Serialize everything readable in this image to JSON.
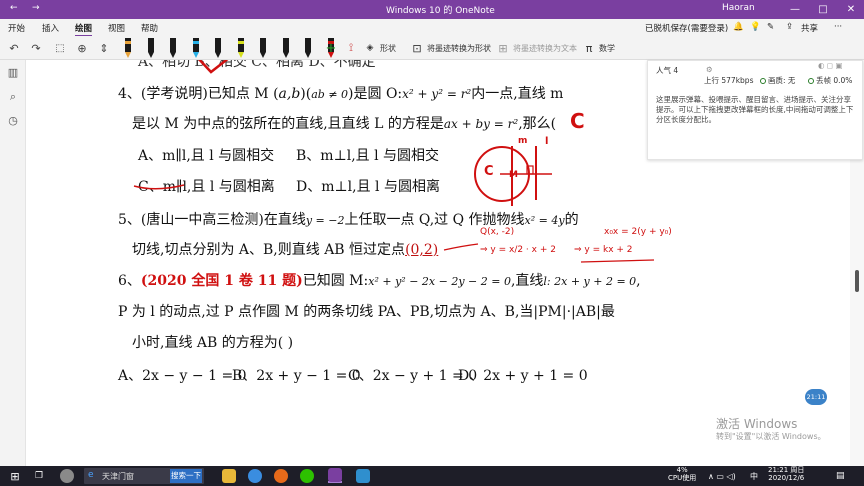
{
  "titlebar": {
    "title": "Windows 10 的 OneNote",
    "user": "Haoran",
    "back_glyph": "←",
    "forward_glyph": "→",
    "minimize_glyph": "—",
    "maximize_glyph": "□",
    "close_glyph": "✕"
  },
  "ribbon": {
    "tabs": [
      "开始",
      "插入",
      "绘图",
      "视图",
      "帮助"
    ],
    "active_tab": "绘图",
    "status": "已脱机保存(需要登录)",
    "share": "共享",
    "more": "···"
  },
  "toolbar": {
    "undo": "↶",
    "redo": "↷",
    "ink_to_shape": "将墨迹转换为形状",
    "ink_to_text": "将墨迹转换为文本",
    "shape": "形状",
    "math": "数学",
    "pen_colors": [
      "#e8a33b",
      "#1a1a1a",
      "#1a1a1a",
      "#27b0e6",
      "#1a1a1a",
      "#d6e01e",
      "#1a1a1a",
      "#1a1a1a",
      "#1a1a1a",
      "#d01010"
    ]
  },
  "content": {
    "cut_line": "A、相切    B、相交    C、相离    D、不确定",
    "q4": {
      "l1_prefix": "4、(学考说明)已知点 M (",
      "l1_ab": "a,b",
      "l1_mid": ")(",
      "l1_cond": "ab ≠ 0",
      "l1_mid2": ")是圆 O:",
      "l1_eq": "x² + y² = r²",
      "l1_suffix": "内一点,直线 m",
      "l2_prefix": "是以 M 为中点的弦所在的直线,且直线 L 的方程是",
      "l2_eq": "ax + by = r²",
      "l2_suffix": ",那么(",
      "optA": "A、m∥l,且 l 与圆相交",
      "optB": "B、m⊥l,且 l 与圆相交",
      "optC": "C、m∥l,且 l 与圆相离",
      "optD": "D、m⊥l,且 l 与圆相离",
      "ink_answer": "C"
    },
    "q5": {
      "l1_prefix": "5、(唐山一中高三检测)在直线",
      "l1_eq": "y = −2",
      "l1_mid": "上任取一点 Q,过 Q 作抛物线",
      "l1_eq2": "x² = 4y",
      "l1_suffix": "的",
      "l2_prefix": "切线,切点分别为 A、B,则直线 AB 恒过定点",
      "l2_blank": "(0,2)"
    },
    "q6": {
      "l1_tag": "(2020 全国 1 卷 11 题)",
      "l1_prefix": "6、",
      "l1_mid": "已知圆 M:",
      "l1_eq": "x² + y² − 2x − 2y − 2 = 0",
      "l1_mid2": ",直线",
      "l1_eq2": "l: 2x + y + 2 = 0",
      "l1_suffix": ",",
      "l2": "P 为 l 的动点,过 P 点作圆 M 的两条切线 PA、PB,切点为 A、B,当|PM|·|AB|最",
      "l3": "小时,直线 AB 的方程为(     )",
      "optA": "A、2x − y − 1 = 0",
      "optB": "B、2x + y − 1 = 0",
      "optC": "C、2x − y + 1 = 0",
      "optD": "D、2x + y + 1 = 0"
    },
    "ink_notes": {
      "n1": "Q(x, -2)",
      "n2": "x₀x = 2(y + y₀)",
      "n3": "⇒ y = x/2 · x + 2",
      "n4": "⇒ y = kx + 2",
      "n5": "y=lcx+2",
      "ink_m": "m",
      "ink_l": "l",
      "ink_c": "C",
      "ink_mm": "M"
    }
  },
  "sidepanel": {
    "popularity": "人气 4",
    "upload": "上行 577kbps",
    "paint": "画质: 无",
    "drop": "丢帧 0.0%",
    "message": "这里展示弹幕、投喂提示、醒目留言、进场提示、关注分享提示。可以上下拖拽更改弹幕框的长度,中间拖动可调整上下分区长度分配比。"
  },
  "timer_bubble": "21:11",
  "watermark": {
    "line1": "激活 Windows",
    "line2": "转到\"设置\"以激活 Windows。"
  },
  "taskbar": {
    "search_placeholder": "天津门窗",
    "search_button": "搜索一下",
    "cpu_pct": "4%",
    "cpu_label": "CPU使用",
    "time": "21:21 周日",
    "date": "2020/12/6",
    "lang": "中",
    "win_glyph": "⊞",
    "taskview_glyph": "❐"
  }
}
